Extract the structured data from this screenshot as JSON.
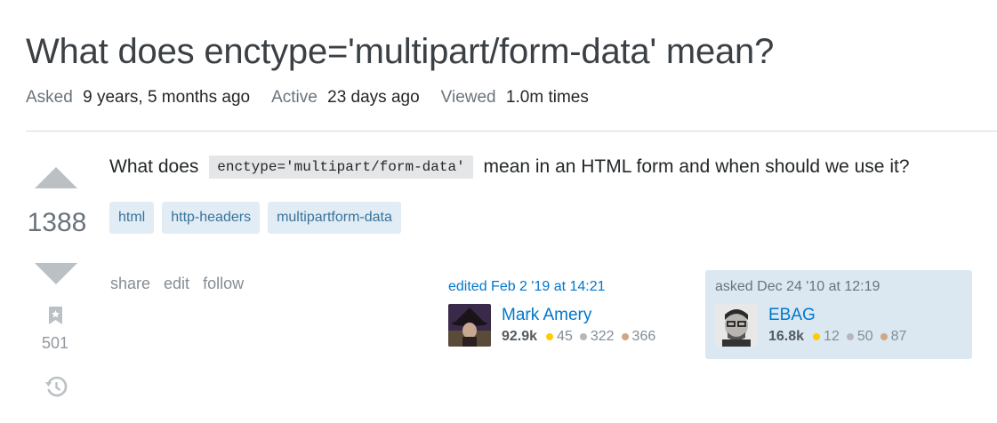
{
  "question": {
    "title": "What does enctype='multipart/form-data' mean?",
    "meta": {
      "asked_label": "Asked",
      "asked_value": "9 years, 5 months ago",
      "active_label": "Active",
      "active_value": "23 days ago",
      "viewed_label": "Viewed",
      "viewed_value": "1.0m times"
    },
    "votes": "1388",
    "bookmarks": "501",
    "body": {
      "before": "What does",
      "code": "enctype='multipart/form-data'",
      "after": "mean in an HTML form and when should we use it?"
    },
    "tags": [
      "html",
      "http-headers",
      "multipartform-data"
    ],
    "menu": {
      "share": "share",
      "edit": "edit",
      "follow": "follow"
    }
  },
  "editor": {
    "action": "edited Feb 2 '19 at 14:21",
    "name": "Mark Amery",
    "reputation": "92.9k",
    "gold": "45",
    "silver": "322",
    "bronze": "366"
  },
  "asker": {
    "action": "asked Dec 24 '10 at 12:19",
    "name": "EBAG",
    "reputation": "16.8k",
    "gold": "12",
    "silver": "50",
    "bronze": "87"
  },
  "colors": {
    "gold": "#ffcc01",
    "silver": "#b4b8bc",
    "bronze": "#d1a684",
    "link": "#0077cc",
    "tag_bg": "#e1ecf4",
    "tag_text": "#39739d",
    "owner_bg": "#dce8f1"
  },
  "icons": {
    "upvote": "triangle-up-icon",
    "downvote": "triangle-down-icon",
    "bookmark": "bookmark-icon",
    "history": "history-icon"
  }
}
